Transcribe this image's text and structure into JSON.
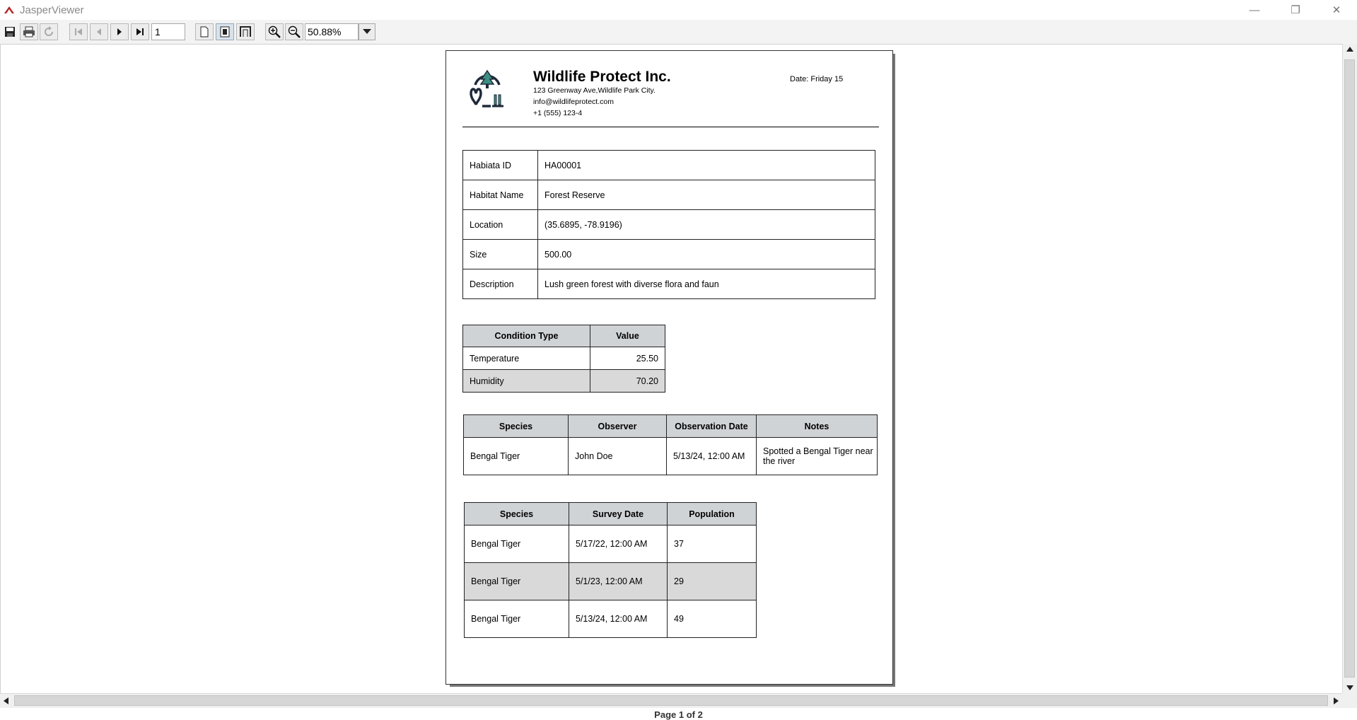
{
  "window": {
    "title": "JasperViewer",
    "minimize": "—",
    "restore": "❐",
    "close": "✕"
  },
  "toolbar": {
    "page_number": "1",
    "zoom": "50.88%",
    "icons": [
      "save-icon",
      "print-icon",
      "reload-icon",
      "first-page-icon",
      "previous-page-icon",
      "next-page-icon",
      "last-page-icon",
      "actual-size-icon",
      "fit-page-icon",
      "fit-width-icon",
      "zoom-in-icon",
      "zoom-out-icon",
      "dropdown-arrow-icon"
    ]
  },
  "report": {
    "company": "Wildlife Protect Inc.",
    "address": "123 Greenway Ave,Wildlife Park City.",
    "email": "info@wildlifeprotect.com",
    "phone": "+1 (555) 123-4",
    "date": "Date: Friday 15",
    "info": [
      {
        "label": "Habiata ID",
        "value": "HA00001"
      },
      {
        "label": "Habitat Name",
        "value": "Forest Reserve"
      },
      {
        "label": "Location",
        "value": "(35.6895, -78.9196)"
      },
      {
        "label": "Size",
        "value": "500.00"
      },
      {
        "label": "Description",
        "value": "Lush green forest with diverse flora and faun"
      }
    ],
    "conditions": {
      "headers": [
        "Condition Type",
        "Value"
      ],
      "rows": [
        {
          "type": "Temperature",
          "value": "25.50"
        },
        {
          "type": "Humidity",
          "value": "70.20"
        }
      ]
    },
    "observations": {
      "headers": [
        "Species",
        "Observer",
        "Observation Date",
        "Notes"
      ],
      "rows": [
        {
          "species": "Bengal Tiger",
          "observer": "John Doe",
          "date": "5/13/24, 12:00 AM",
          "notes": "Spotted a Bengal Tiger near the river"
        }
      ]
    },
    "population": {
      "headers": [
        "Species",
        "Survey Date",
        "Population"
      ],
      "rows": [
        {
          "species": "Bengal Tiger",
          "date": "5/17/22, 12:00 AM",
          "population": "37"
        },
        {
          "species": "Bengal Tiger",
          "date": "5/1/23, 12:00 AM",
          "population": "29"
        },
        {
          "species": "Bengal Tiger",
          "date": "5/13/24, 12:00 AM",
          "population": "49"
        }
      ]
    }
  },
  "status": {
    "page_label": "Page 1 of 2"
  },
  "colors": {
    "header_fill": "#d0d3d6",
    "alt_row_fill": "#d9d9d9",
    "logo_dark": "#1f2a3a",
    "logo_accent": "#3c8f82"
  }
}
